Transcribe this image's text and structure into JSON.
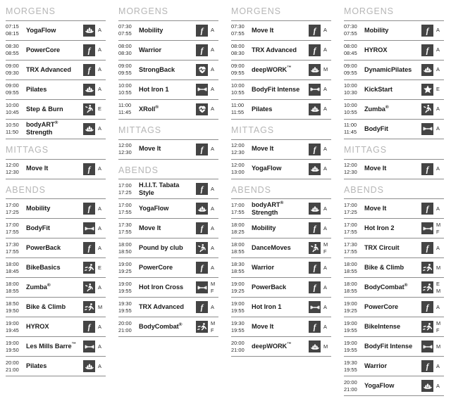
{
  "schedule": {
    "section_labels": {
      "morning": "MORGENS",
      "noon": "MITTAGS",
      "evening": "ABENDS"
    },
    "colors": {
      "icon_background": "#444444",
      "icon_glyph": "#ffffff",
      "rule": "#8d8d8d",
      "section_heading": "#b6b6b6",
      "text": "#1a1a1a"
    },
    "icon_names": {
      "f": "f-logo-icon",
      "dumbbell": "dumbbell-icon",
      "lotus": "lotus-icon",
      "heart": "heart-pulse-icon",
      "runner": "runner-icon",
      "dancer": "dancer-icon",
      "star": "star-icon"
    },
    "columns": [
      {
        "sections": [
          {
            "label": "MORGENS",
            "classes": [
              {
                "start": "07:15",
                "end": "08:15",
                "name": "YogaFlow",
                "icon": "lotus",
                "trainer": "A"
              },
              {
                "start": "08:30",
                "end": "08:55",
                "name": "PowerCore",
                "icon": "f",
                "trainer": "A"
              },
              {
                "start": "09:00",
                "end": "09:30",
                "name": "TRX Advanced",
                "icon": "f",
                "trainer": "A"
              },
              {
                "start": "09:00",
                "end": "09:55",
                "name": "Pilates",
                "icon": "lotus",
                "trainer": "A"
              },
              {
                "start": "10:00",
                "end": "10:45",
                "name": "Step & Burn",
                "icon": "dancer",
                "trainer": "E"
              },
              {
                "start": "10:50",
                "end": "11:50",
                "name": "bodyART® Strength",
                "icon": "lotus",
                "trainer": "A"
              }
            ]
          },
          {
            "label": "MITTAGS",
            "classes": [
              {
                "start": "12:00",
                "end": "12:30",
                "name": "Move It",
                "icon": "f",
                "trainer": "A"
              }
            ]
          },
          {
            "label": "ABENDS",
            "classes": [
              {
                "start": "17:00",
                "end": "17:25",
                "name": "Mobility",
                "icon": "f",
                "trainer": "A"
              },
              {
                "start": "17:00",
                "end": "17:55",
                "name": "BodyFit",
                "icon": "dumbbell",
                "trainer": "A"
              },
              {
                "start": "17:30",
                "end": "17:55",
                "name": "PowerBack",
                "icon": "f",
                "trainer": "A"
              },
              {
                "start": "18:00",
                "end": "18:45",
                "name": "BikeBasics",
                "icon": "runner",
                "trainer": "E"
              },
              {
                "start": "18:00",
                "end": "18:55",
                "name": "Zumba®",
                "icon": "dancer",
                "trainer": "A"
              },
              {
                "start": "18:50",
                "end": "19:50",
                "name": "Bike & Climb",
                "icon": "runner",
                "trainer": "M"
              },
              {
                "start": "19:00",
                "end": "19:45",
                "name": "HYROX",
                "icon": "f",
                "trainer": "A"
              },
              {
                "start": "19:00",
                "end": "19:50",
                "name": "Les Mills Barre™",
                "icon": "dumbbell",
                "trainer": "A"
              },
              {
                "start": "20:00",
                "end": "21:00",
                "name": "Pilates",
                "icon": "lotus",
                "trainer": "A"
              }
            ]
          }
        ]
      },
      {
        "sections": [
          {
            "label": "MORGENS",
            "classes": [
              {
                "start": "07:30",
                "end": "07:55",
                "name": "Mobility",
                "icon": "f",
                "trainer": "A"
              },
              {
                "start": "08:00",
                "end": "08:30",
                "name": "Warrior",
                "icon": "f",
                "trainer": "A"
              },
              {
                "start": "09:00",
                "end": "09:55",
                "name": "StrongBack",
                "icon": "heart",
                "trainer": "A"
              },
              {
                "start": "10:00",
                "end": "10:55",
                "name": "Hot Iron 1",
                "icon": "dumbbell",
                "trainer": "A"
              },
              {
                "start": "11:00",
                "end": "11:45",
                "name": "XRoll®",
                "icon": "heart",
                "trainer": "A"
              }
            ]
          },
          {
            "label": "MITTAGS",
            "classes": [
              {
                "start": "12:00",
                "end": "12:30",
                "name": "Move It",
                "icon": "f",
                "trainer": "A"
              }
            ]
          },
          {
            "label": "ABENDS",
            "classes": [
              {
                "start": "17:00",
                "end": "17:25",
                "name": "H.I.I.T. Tabata Style",
                "icon": "f",
                "trainer": "A"
              },
              {
                "start": "17:00",
                "end": "17:55",
                "name": "YogaFlow",
                "icon": "lotus",
                "trainer": "A"
              },
              {
                "start": "17:30",
                "end": "17:55",
                "name": "Move It",
                "icon": "f",
                "trainer": "A"
              },
              {
                "start": "18:00",
                "end": "18:50",
                "name": "Pound by club",
                "icon": "dancer",
                "trainer": "A"
              },
              {
                "start": "19:00",
                "end": "19:25",
                "name": "PowerCore",
                "icon": "f",
                "trainer": "A"
              },
              {
                "start": "19:00",
                "end": "19:55",
                "name": "Hot Iron Cross",
                "icon": "dumbbell",
                "trainer": "M F"
              },
              {
                "start": "19:30",
                "end": "19:55",
                "name": "TRX Advanced",
                "icon": "f",
                "trainer": "A"
              },
              {
                "start": "20:00",
                "end": "21:00",
                "name": "BodyCombat®",
                "icon": "runner",
                "trainer": "M F"
              }
            ]
          }
        ]
      },
      {
        "sections": [
          {
            "label": "MORGENS",
            "classes": [
              {
                "start": "07:30",
                "end": "07:55",
                "name": "Move It",
                "icon": "f",
                "trainer": "A"
              },
              {
                "start": "08:00",
                "end": "08:30",
                "name": "TRX Advanced",
                "icon": "f",
                "trainer": "A"
              },
              {
                "start": "09:00",
                "end": "09:55",
                "name": "deepWORK™",
                "icon": "lotus",
                "trainer": "M"
              },
              {
                "start": "10:00",
                "end": "10:55",
                "name": "BodyFit Intense",
                "icon": "dumbbell",
                "trainer": "A"
              },
              {
                "start": "11:00",
                "end": "11:55",
                "name": "Pilates",
                "icon": "lotus",
                "trainer": "A"
              }
            ]
          },
          {
            "label": "MITTAGS",
            "classes": [
              {
                "start": "12:00",
                "end": "12:30",
                "name": "Move It",
                "icon": "f",
                "trainer": "A"
              },
              {
                "start": "12:00",
                "end": "13:00",
                "name": "YogaFlow",
                "icon": "lotus",
                "trainer": "A"
              }
            ]
          },
          {
            "label": "ABENDS",
            "classes": [
              {
                "start": "17:00",
                "end": "17:55",
                "name": "bodyART® Strength",
                "icon": "lotus",
                "trainer": "A"
              },
              {
                "start": "18:00",
                "end": "18:25",
                "name": "Mobility",
                "icon": "f",
                "trainer": "A"
              },
              {
                "start": "18:00",
                "end": "18:55",
                "name": "DanceMoves",
                "icon": "dancer",
                "trainer": "M F"
              },
              {
                "start": "18:30",
                "end": "18:55",
                "name": "Warrior",
                "icon": "f",
                "trainer": "A"
              },
              {
                "start": "19:00",
                "end": "19:25",
                "name": "PowerBack",
                "icon": "f",
                "trainer": "A"
              },
              {
                "start": "19:00",
                "end": "19:55",
                "name": "Hot Iron 1",
                "icon": "dumbbell",
                "trainer": "A"
              },
              {
                "start": "19:30",
                "end": "19:55",
                "name": "Move It",
                "icon": "f",
                "trainer": "A"
              },
              {
                "start": "20:00",
                "end": "21:00",
                "name": "deepWORK™",
                "icon": "lotus",
                "trainer": "M"
              }
            ]
          }
        ]
      },
      {
        "sections": [
          {
            "label": "MORGENS",
            "classes": [
              {
                "start": "07:30",
                "end": "07:55",
                "name": "Mobility",
                "icon": "f",
                "trainer": "A"
              },
              {
                "start": "08:00",
                "end": "08:45",
                "name": "HYROX",
                "icon": "f",
                "trainer": "A"
              },
              {
                "start": "09:00",
                "end": "09:55",
                "name": "DynamicPilates",
                "icon": "lotus",
                "trainer": "A"
              },
              {
                "start": "10:00",
                "end": "10:30",
                "name": "KickStart",
                "icon": "star",
                "trainer": "E"
              },
              {
                "start": "10:00",
                "end": "10:55",
                "name": "Zumba®",
                "icon": "dancer",
                "trainer": "A"
              },
              {
                "start": "11:00",
                "end": "11:45",
                "name": "BodyFit",
                "icon": "dumbbell",
                "trainer": "A"
              }
            ]
          },
          {
            "label": "MITTAGS",
            "classes": [
              {
                "start": "12:00",
                "end": "12:30",
                "name": "Move It",
                "icon": "f",
                "trainer": "A"
              }
            ]
          },
          {
            "label": "ABENDS",
            "classes": [
              {
                "start": "17:00",
                "end": "17:25",
                "name": "Move It",
                "icon": "f",
                "trainer": "A"
              },
              {
                "start": "17:00",
                "end": "17:55",
                "name": "Hot Iron 2",
                "icon": "dumbbell",
                "trainer": "M F"
              },
              {
                "start": "17:30",
                "end": "17:55",
                "name": "TRX Circuit",
                "icon": "f",
                "trainer": "A"
              },
              {
                "start": "18:00",
                "end": "18:55",
                "name": "Bike & Climb",
                "icon": "runner",
                "trainer": "M"
              },
              {
                "start": "18:00",
                "end": "18:55",
                "name": "BodyCombat®",
                "icon": "runner",
                "trainer": "E M"
              },
              {
                "start": "19:00",
                "end": "19:25",
                "name": "PowerCore",
                "icon": "f",
                "trainer": "A"
              },
              {
                "start": "19:00",
                "end": "19:55",
                "name": "BikeIntense",
                "icon": "runner",
                "trainer": "M F"
              },
              {
                "start": "19:00",
                "end": "19:55",
                "name": "BodyFit Intense",
                "icon": "dumbbell",
                "trainer": "M"
              },
              {
                "start": "19:30",
                "end": "19:55",
                "name": "Warrior",
                "icon": "f",
                "trainer": "A"
              },
              {
                "start": "20:00",
                "end": "21:00",
                "name": "YogaFlow",
                "icon": "lotus",
                "trainer": "A"
              }
            ]
          }
        ]
      }
    ]
  }
}
